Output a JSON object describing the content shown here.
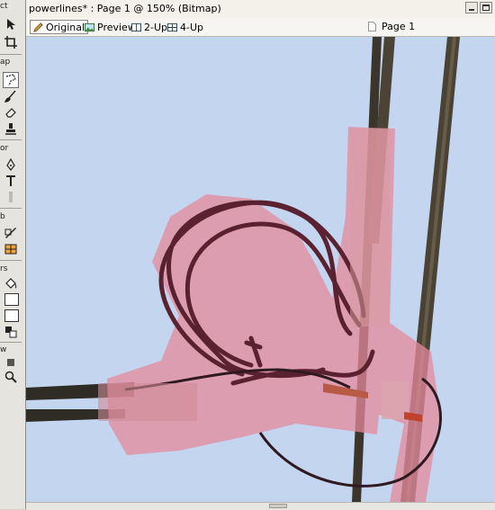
{
  "tools_panel": {
    "sections": [
      "ct",
      "ap",
      "or",
      "b",
      "rs",
      "w"
    ]
  },
  "document": {
    "title": "powerlines* : Page 1 @ 150% (Bitmap)",
    "tabs": [
      {
        "label": "Original",
        "icon": "pencil-icon",
        "active": true
      },
      {
        "label": "Preview",
        "icon": "image-icon",
        "active": false
      },
      {
        "label": "2-Up",
        "icon": "two-up-icon",
        "active": false
      },
      {
        "label": "4-Up",
        "icon": "four-up-icon",
        "active": false
      }
    ],
    "page_label": "Page 1"
  },
  "colors": {
    "sky": "#c7d8f1",
    "mask": "#e79aa8",
    "pole": "#4a4234"
  }
}
